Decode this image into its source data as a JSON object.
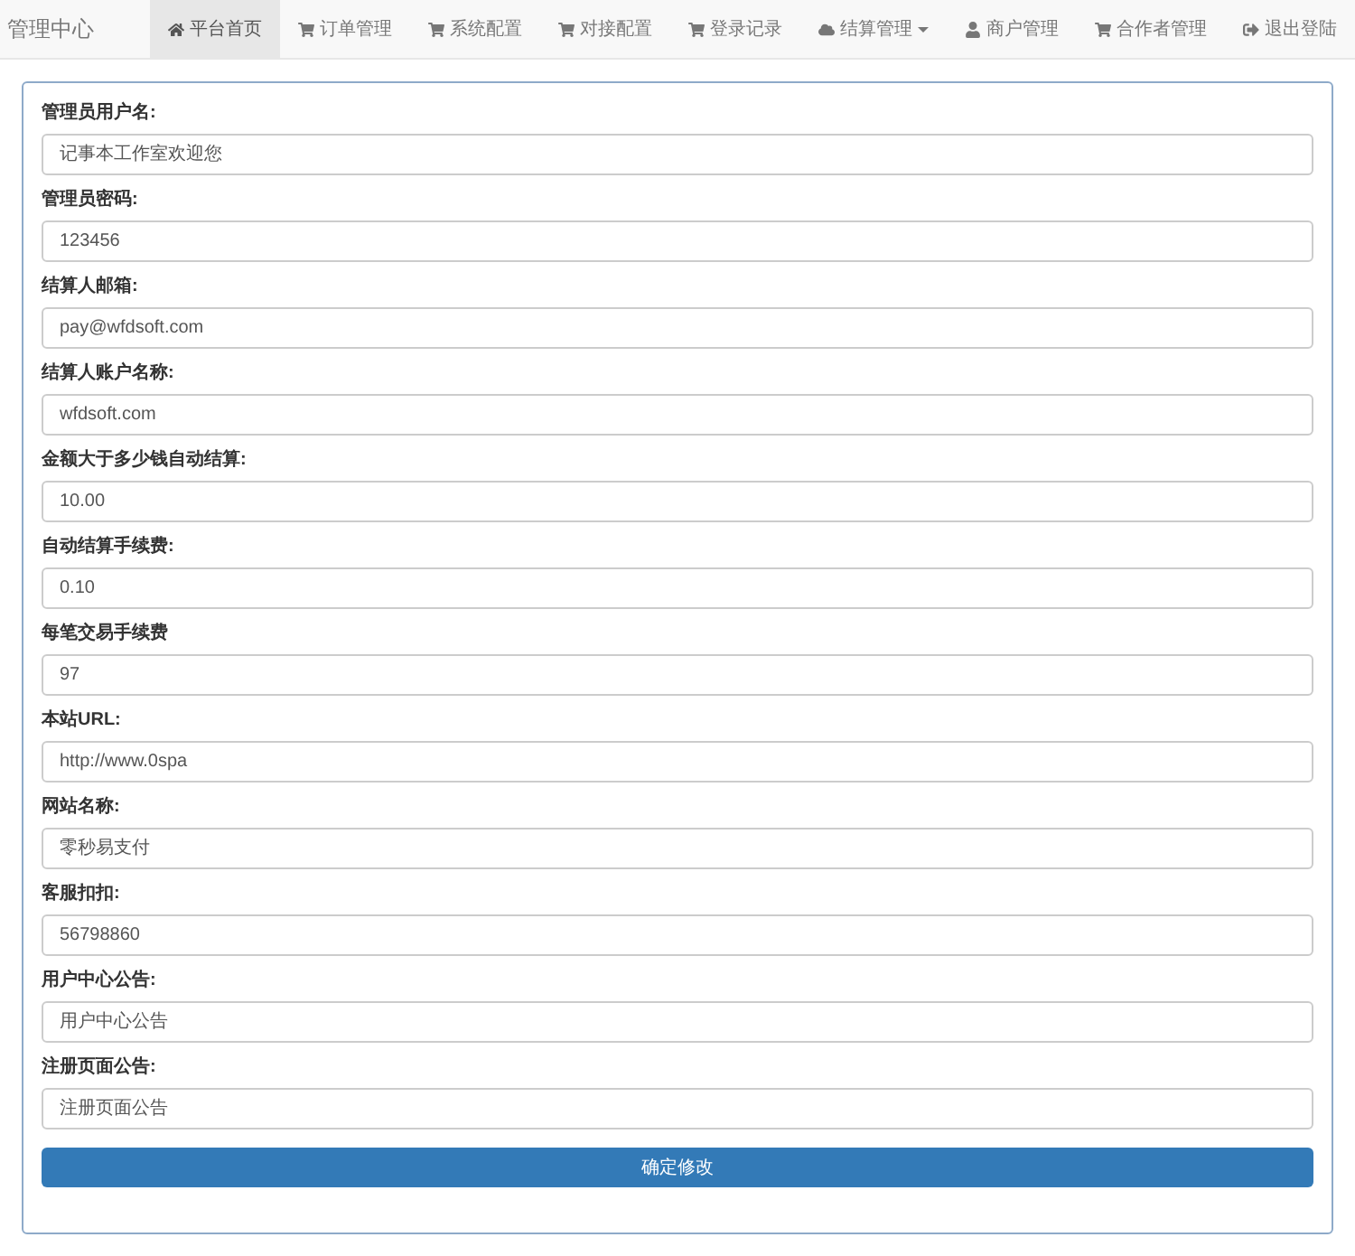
{
  "navbar": {
    "brand": "管理中心",
    "items": [
      {
        "label": "平台首页",
        "kind": "home",
        "selected": true,
        "dropdown": false
      },
      {
        "label": "订单管理",
        "kind": "cart",
        "selected": false,
        "dropdown": false
      },
      {
        "label": "系统配置",
        "kind": "cart",
        "selected": false,
        "dropdown": false
      },
      {
        "label": "对接配置",
        "kind": "cart",
        "selected": false,
        "dropdown": false
      },
      {
        "label": "登录记录",
        "kind": "cart",
        "selected": false,
        "dropdown": false
      },
      {
        "label": "结算管理",
        "kind": "cloud",
        "selected": false,
        "dropdown": true
      },
      {
        "label": "商户管理",
        "kind": "user",
        "selected": false,
        "dropdown": false
      },
      {
        "label": "合作者管理",
        "kind": "cart",
        "selected": false,
        "dropdown": false
      },
      {
        "label": "退出登陆",
        "kind": "logout",
        "selected": false,
        "dropdown": false
      }
    ]
  },
  "form": {
    "fields": [
      {
        "label": "管理员用户名:",
        "value": "记事本工作室欢迎您"
      },
      {
        "label": "管理员密码:",
        "value": "123456"
      },
      {
        "label": "结算人邮箱:",
        "value": "pay@wfdsoft.com"
      },
      {
        "label": "结算人账户名称:",
        "value": "wfdsoft.com"
      },
      {
        "label": "金额大于多少钱自动结算:",
        "value": "10.00"
      },
      {
        "label": "自动结算手续费:",
        "value": "0.10"
      },
      {
        "label": "每笔交易手续费",
        "value": "97"
      },
      {
        "label": "本站URL:",
        "value": "http://www.0spa"
      },
      {
        "label": "网站名称:",
        "value": "零秒易支付"
      },
      {
        "label": "客服扣扣:",
        "value": "56798860"
      },
      {
        "label": "用户中心公告:",
        "value": "用户中心公告"
      },
      {
        "label": "注册页面公告:",
        "value": "注册页面公告"
      }
    ],
    "submit": "确定修改"
  }
}
